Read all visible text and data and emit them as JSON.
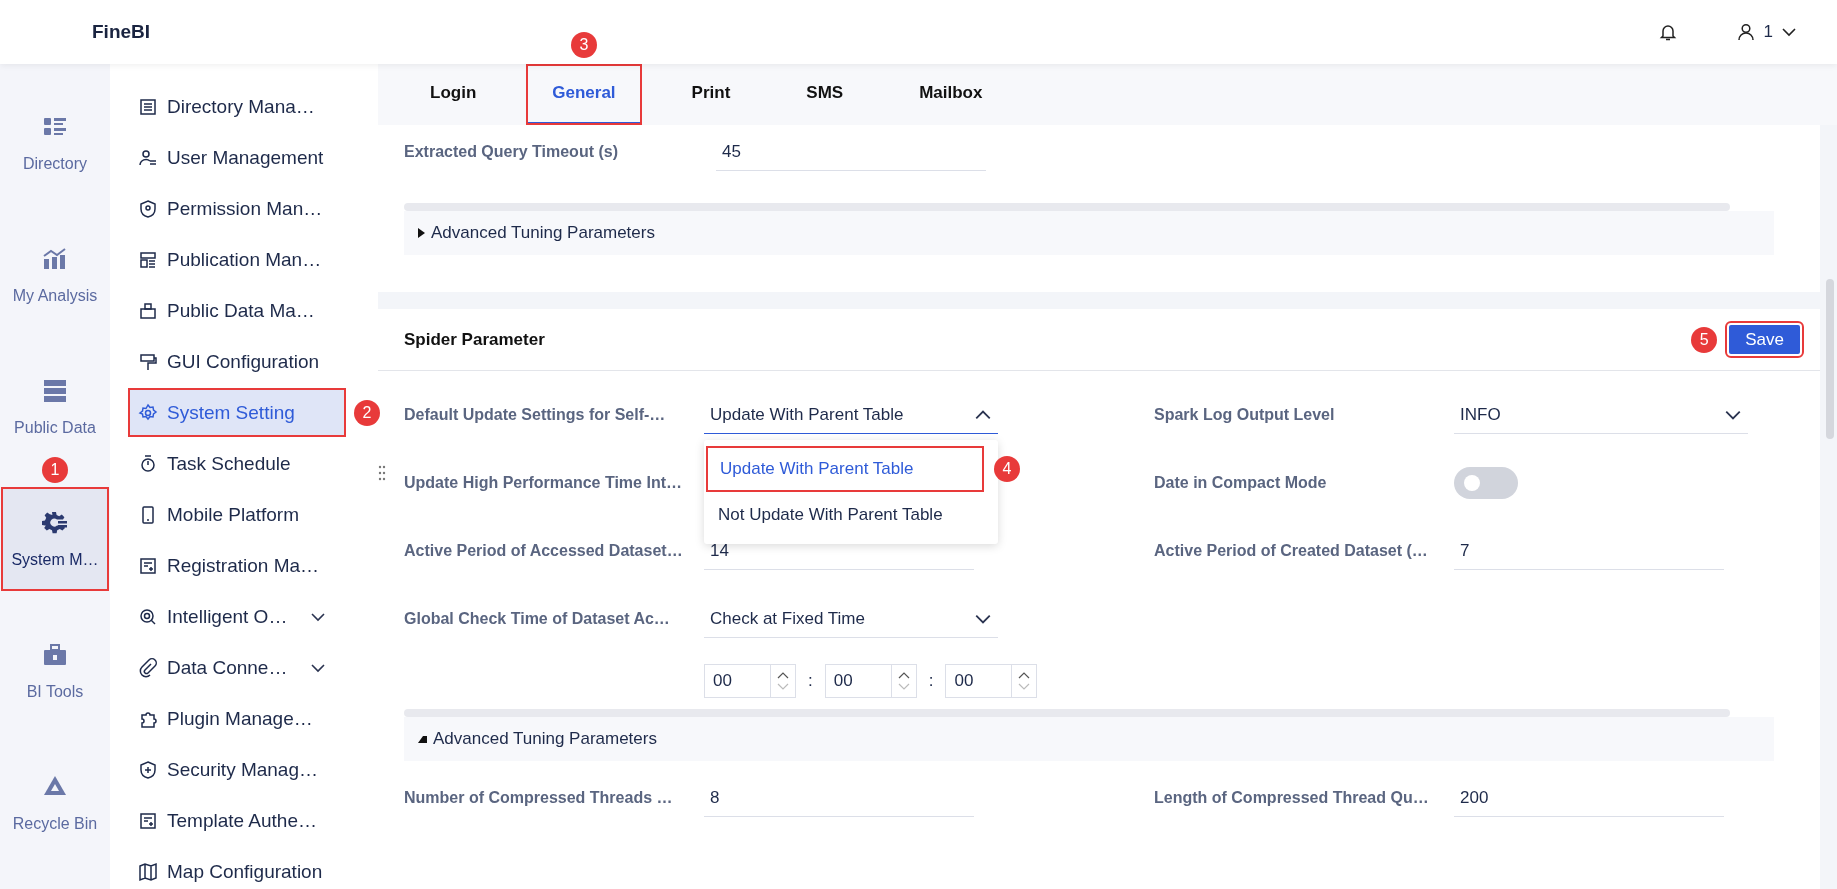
{
  "header": {
    "logo": "FineBI",
    "user": "1"
  },
  "rail": [
    {
      "label": "Directory",
      "selected": false
    },
    {
      "label": "My Analysis",
      "selected": false
    },
    {
      "label": "Public Data",
      "selected": false
    },
    {
      "label": "System M…",
      "selected": true,
      "marker": "1"
    },
    {
      "label": "BI Tools",
      "selected": false
    },
    {
      "label": "Recycle Bin",
      "selected": false
    }
  ],
  "submenu": [
    {
      "label": "Directory Mana…",
      "selected": false
    },
    {
      "label": "User Management",
      "selected": false
    },
    {
      "label": "Permission Man…",
      "selected": false
    },
    {
      "label": "Publication Man…",
      "selected": false
    },
    {
      "label": "Public Data Ma…",
      "selected": false
    },
    {
      "label": "GUI Configuration",
      "selected": false
    },
    {
      "label": "System Setting",
      "selected": true,
      "marker": "2"
    },
    {
      "label": "Task Schedule",
      "selected": false
    },
    {
      "label": "Mobile Platform",
      "selected": false
    },
    {
      "label": "Registration Ma…",
      "selected": false
    },
    {
      "label": "Intelligent O…",
      "selected": false,
      "expandable": true
    },
    {
      "label": "Data Conne…",
      "selected": false,
      "expandable": true
    },
    {
      "label": "Plugin Manage…",
      "selected": false
    },
    {
      "label": "Security Manag…",
      "selected": false
    },
    {
      "label": "Template Authe…",
      "selected": false
    },
    {
      "label": "Map Configuration",
      "selected": false
    }
  ],
  "tabs": [
    {
      "label": "Login",
      "selected": false
    },
    {
      "label": "General",
      "selected": true,
      "marker": "3"
    },
    {
      "label": "Print",
      "selected": false
    },
    {
      "label": "SMS",
      "selected": false
    },
    {
      "label": "Mailbox",
      "selected": false
    }
  ],
  "general_section": {
    "fields": [
      {
        "label": "Extracted Query Timeout (s)",
        "value": "45"
      }
    ],
    "advanced": {
      "label": "Advanced Tuning Parameters",
      "expanded": false
    }
  },
  "spider_section": {
    "title": "Spider Parameter",
    "save": {
      "label": "Save",
      "marker": "5"
    },
    "left_fields": [
      {
        "kind": "select",
        "label": "Default Update Settings for Self-…",
        "value": "Update With Parent Table",
        "expanded": true,
        "options": [
          {
            "label": "Update With Parent Table",
            "selected": true,
            "marker": "4"
          },
          {
            "label": "Not Update With Parent Table",
            "selected": false
          }
        ]
      },
      {
        "kind": "label",
        "label": "Update High Performance Time Int…"
      },
      {
        "kind": "text",
        "label": "Active Period of Accessed Dataset…",
        "value": "14"
      },
      {
        "kind": "select",
        "label": "Global Check Time of Dataset Ac…",
        "value": "Check at Fixed Time",
        "expanded": false
      },
      {
        "kind": "time",
        "values": [
          "00",
          "00",
          "00"
        ],
        "separators": [
          ":",
          ":"
        ]
      }
    ],
    "right_fields": [
      {
        "kind": "select",
        "label": "Spark Log Output Level",
        "value": "INFO",
        "expanded": false
      },
      {
        "kind": "toggle",
        "label": "Date in Compact Mode",
        "on": false
      },
      {
        "kind": "text",
        "label": "Active Period of Created Dataset (…",
        "value": "7"
      }
    ],
    "advanced": {
      "label": "Advanced Tuning Parameters",
      "expanded": true
    },
    "advanced_left": [
      {
        "kind": "text",
        "label": "Number of Compressed Threads …",
        "value": "8"
      }
    ],
    "advanced_right": [
      {
        "kind": "text",
        "label": "Length of Compressed Thread Qu…",
        "value": "200"
      }
    ]
  }
}
